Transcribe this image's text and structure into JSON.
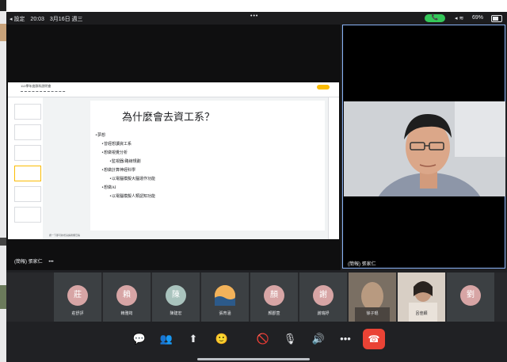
{
  "status_bar": {
    "back_label": "◂ 設定",
    "time": "20:03",
    "date": "3月16日 週三",
    "dots": "•••",
    "battery": "69%"
  },
  "presentation": {
    "doc_title": "112學年度群科說明會",
    "slide": {
      "title": "為什麼會去資工系？",
      "lines": [
        "•夢想",
        "•曾經想讀資工系",
        "•想做視覺分析",
        "•監視器/路線規劃",
        "•想做計算神經科學",
        "•以電腦模擬大腦運作功能",
        "•想做AI",
        "•以電腦模擬人類認知功能"
      ]
    },
    "notes": "按一下即可新增演講者備忘稿",
    "presenter_name": "(簡報) 張家仁",
    "more_glyph": "•••"
  },
  "speaker": {
    "name": "(簡報) 張家仁"
  },
  "participants": [
    {
      "initial": "莊",
      "name": "莊舒評",
      "color": "#d7a5a5"
    },
    {
      "initial": "賴",
      "name": "賴雅筠",
      "color": "#d7a5a5"
    },
    {
      "initial": "陳",
      "name": "陳建宏",
      "color": "#a9c3bd"
    },
    {
      "initial": "",
      "name": "張育涵",
      "color": "#e09a3b"
    },
    {
      "initial": "顏",
      "name": "顏郡萱",
      "color": "#d7a5a5"
    },
    {
      "initial": "謝",
      "name": "謝瑞妤",
      "color": "#d7a5a5"
    },
    {
      "initial": "",
      "name": "徐子琨",
      "color": "#8a8177"
    },
    {
      "initial": "",
      "name": "呂佳穎",
      "color": "#b49b88"
    },
    {
      "initial": "劉",
      "name": "",
      "color": "#d7a5a5"
    }
  ],
  "controls": {
    "chat": "💬",
    "people": "👥",
    "present": "⬆",
    "reactions": "🙂",
    "camera_off": "🚫",
    "mic_off": "🎙",
    "speaker": "🔊",
    "more": "•••",
    "end": "☎"
  },
  "colors": {
    "accent": "#8ab4f8",
    "end_call": "#ea4335",
    "share": "#fbbc04"
  }
}
